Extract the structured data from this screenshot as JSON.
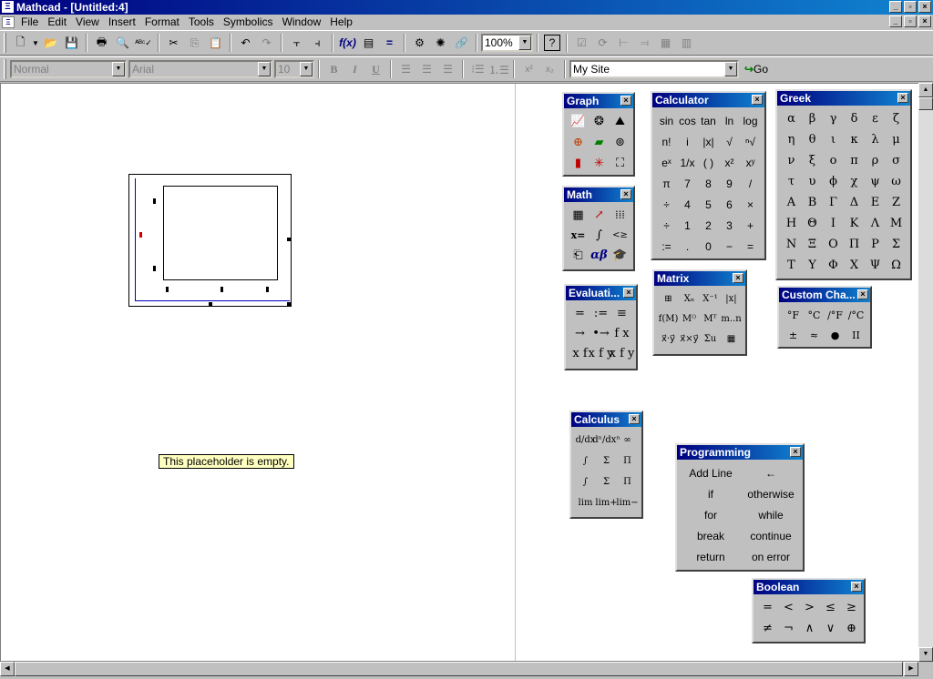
{
  "app": {
    "title": "Mathcad - [Untitled:4]",
    "title_icon": "mathcad-icon"
  },
  "window_buttons": {
    "minimize": "_",
    "restore": "▫",
    "close": "×"
  },
  "menu": [
    "File",
    "Edit",
    "View",
    "Insert",
    "Format",
    "Tools",
    "Symbolics",
    "Window",
    "Help"
  ],
  "standard_toolbar": {
    "zoom": "100%",
    "icons": [
      "new-icon",
      "open-icon",
      "save-icon",
      "print-icon",
      "print-preview-icon",
      "spell-check-icon",
      "cut-icon",
      "copy-icon",
      "paste-icon",
      "undo-icon",
      "redo-icon",
      "align-across-icon",
      "align-down-icon",
      "insert-function-icon",
      "insert-unit-icon",
      "calculate-icon",
      "component-icon",
      "resource-center-icon",
      "help-icon"
    ]
  },
  "formatting_toolbar": {
    "style": "Normal",
    "font": "Arial",
    "size": "10",
    "bold": "B",
    "italic": "I",
    "underline": "U",
    "site": "My Site",
    "go_label": "Go"
  },
  "tooltip": "This placeholder is empty.",
  "palettes": {
    "graph": {
      "title": "Graph"
    },
    "math": {
      "title": "Math"
    },
    "calculator": {
      "title": "Calculator",
      "cells": [
        "sin",
        "cos",
        "tan",
        "ln",
        "log",
        "n!",
        "i",
        "|x|",
        "√",
        "ⁿ√",
        "eˣ",
        "1/x",
        "( )",
        "x²",
        "xʸ",
        "π",
        "7",
        "8",
        "9",
        "/",
        "÷",
        "4",
        "5",
        "6",
        "×",
        "÷",
        "1",
        "2",
        "3",
        "+",
        ":=",
        ".",
        "0",
        "−",
        "="
      ]
    },
    "greek": {
      "title": "Greek",
      "cells": [
        "α",
        "β",
        "γ",
        "δ",
        "ε",
        "ζ",
        "η",
        "θ",
        "ι",
        "κ",
        "λ",
        "μ",
        "ν",
        "ξ",
        "ο",
        "π",
        "ρ",
        "σ",
        "τ",
        "υ",
        "ϕ",
        "χ",
        "ψ",
        "ω",
        "Α",
        "Β",
        "Γ",
        "Δ",
        "Ε",
        "Ζ",
        "Η",
        "Θ",
        "Ι",
        "Κ",
        "Λ",
        "Μ",
        "Ν",
        "Ξ",
        "Ο",
        "Π",
        "Ρ",
        "Σ",
        "Τ",
        "Υ",
        "Φ",
        "Χ",
        "Ψ",
        "Ω"
      ]
    },
    "evaluation": {
      "title": "Evaluati...",
      "cells": [
        "=",
        ":=",
        "≡",
        "→",
        "•→",
        "f x",
        "x f",
        "x f y",
        "x f y"
      ]
    },
    "matrix": {
      "title": "Matrix",
      "cells": [
        "⊞",
        "Xₙ",
        "X⁻¹",
        "|x|",
        "f(M)",
        "M⁽⁾",
        "Mᵀ",
        "m..n",
        "x⃗·y⃗",
        "x⃗×y⃗",
        "Σu",
        "▦"
      ]
    },
    "custom": {
      "title": "Custom Cha...",
      "cells": [
        "°F",
        "°C",
        "/°F",
        "/°C",
        "±",
        "≈",
        "●",
        "II"
      ]
    },
    "calculus": {
      "title": "Calculus",
      "cells": [
        "d/dx",
        "dⁿ/dxⁿ",
        "∞",
        "∫",
        "Σ",
        "Π",
        "∫",
        "Σ",
        "Π",
        "lim",
        "lim+",
        "lim−"
      ]
    },
    "programming": {
      "title": "Programming",
      "cells": [
        "Add Line",
        "←",
        "if",
        "otherwise",
        "for",
        "while",
        "break",
        "continue",
        "return",
        "on error"
      ]
    },
    "boolean": {
      "title": "Boolean",
      "cells": [
        "=",
        "<",
        ">",
        "≤",
        "≥",
        "≠",
        "¬",
        "∧",
        "∨",
        "⊕"
      ]
    }
  }
}
